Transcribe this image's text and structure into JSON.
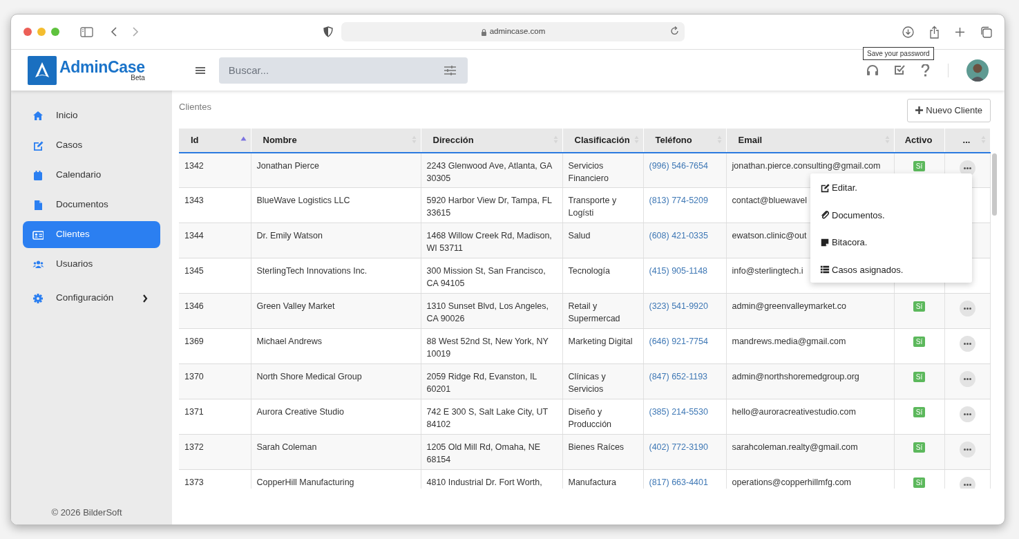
{
  "browser": {
    "url": "admincase.com"
  },
  "app": {
    "brand": "AdminCase",
    "edition": "Beta"
  },
  "search": {
    "placeholder": "Buscar..."
  },
  "tooltip": "Save your password",
  "sidebar": {
    "items": [
      {
        "label": "Inicio",
        "selected": false
      },
      {
        "label": "Casos",
        "selected": false
      },
      {
        "label": "Calendario",
        "selected": false
      },
      {
        "label": "Documentos",
        "selected": false
      },
      {
        "label": "Clientes",
        "selected": true
      },
      {
        "label": "Usuarios",
        "selected": false
      },
      {
        "label": "Configuración",
        "selected": false,
        "expanded": false
      }
    ],
    "footer": "© 2026 BilderSoft"
  },
  "page": {
    "breadcrumb": "Clientes",
    "new_button": "Nuevo Cliente"
  },
  "table": {
    "columns": [
      {
        "label": "Id",
        "sorted": true
      },
      {
        "label": "Nombre",
        "sorted": false
      },
      {
        "label": "Dirección",
        "sorted": false
      },
      {
        "label": "Clasificación",
        "sorted": false
      },
      {
        "label": "Teléfono",
        "sorted": false
      },
      {
        "label": "Email",
        "sorted": false
      },
      {
        "label": "Activo"
      },
      {
        "label": "...",
        "sorted": false
      }
    ],
    "rows": [
      {
        "id": "1342",
        "name": "Jonathan Pierce",
        "address": "2243 Glenwood Ave, Atlanta, GA 30305",
        "classification": "Servicios Financiero",
        "phone": "(996) 546-7654",
        "email": "jonathan.pierce.consulting@gmail.com",
        "active": "Sí",
        "actions": true
      },
      {
        "id": "1343",
        "name": "BlueWave Logistics LLC",
        "address": "5920 Harbor View Dr, Tampa, FL 33615",
        "classification": "Transporte y Logísti",
        "phone": "(813) 774-5209",
        "email": "contact@bluewavel",
        "actions": false
      },
      {
        "id": "1344",
        "name": "Dr. Emily Watson",
        "address": "1468 Willow Creek Rd, Madison, WI 53711",
        "classification": "Salud",
        "phone": "(608) 421-0335",
        "email": "ewatson.clinic@out",
        "actions": false
      },
      {
        "id": "1345",
        "name": "SterlingTech Innovations Inc.",
        "address": "300 Mission St, San Francisco, CA 94105",
        "classification": "Tecnología",
        "phone": "(415) 905-1148",
        "email": "info@sterlingtech.i",
        "actions": false
      },
      {
        "id": "1346",
        "name": "Green Valley Market",
        "address": "1310 Sunset Blvd, Los Angeles, CA 90026",
        "classification": "Retail y Supermercad",
        "phone": "(323) 541-9920",
        "email": "admin@greenvalleymarket.co",
        "active": "Sí",
        "actions": true
      },
      {
        "id": "1369",
        "name": "Michael Andrews",
        "address": "88 West 52nd St, New York, NY 10019",
        "classification": "Marketing Digital",
        "phone": "(646) 921-7754",
        "email": "mandrews.media@gmail.com",
        "active": "Sí",
        "actions": true
      },
      {
        "id": "1370",
        "name": "North Shore Medical Group",
        "address": "2059 Ridge Rd, Evanston, IL 60201",
        "classification": "Clínicas y Servicios",
        "phone": "(847) 652-1193",
        "email": "admin@northshoremedgroup.org",
        "active": "Sí",
        "actions": true
      },
      {
        "id": "1371",
        "name": "Aurora Creative Studio",
        "address": "742 E 300 S, Salt Lake City, UT 84102",
        "classification": "Diseño y Producción",
        "phone": "(385) 214-5530",
        "email": "hello@auroracreativestudio.com",
        "active": "Sí",
        "actions": true
      },
      {
        "id": "1372",
        "name": "Sarah Coleman",
        "address": "1205 Old Mill Rd, Omaha, NE 68154",
        "classification": "Bienes Raíces",
        "phone": "(402) 772-3190",
        "email": "sarahcoleman.realty@gmail.com",
        "active": "Sí",
        "actions": true
      },
      {
        "id": "1373",
        "name": "CopperHill Manufacturing",
        "address": "4810 Industrial Dr. Fort Worth,",
        "classification": "Manufactura",
        "phone": "(817) 663-4401",
        "email": "operations@copperhillmfg.com",
        "active": "Sí",
        "actions": true
      }
    ]
  },
  "menu": {
    "items": [
      {
        "label": "Editar."
      },
      {
        "label": "Documentos."
      },
      {
        "label": "Bitacora."
      },
      {
        "label": "Casos asignados."
      }
    ]
  }
}
